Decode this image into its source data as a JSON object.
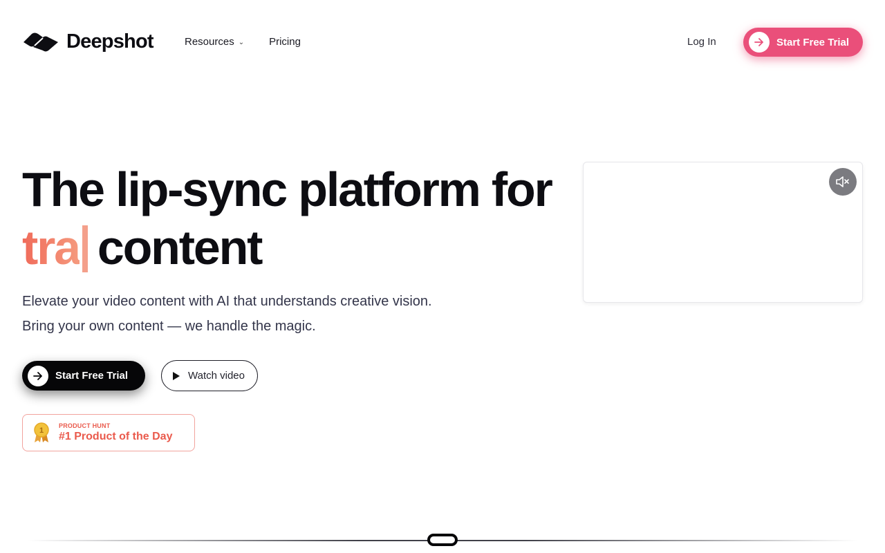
{
  "header": {
    "brand": "Deepshot",
    "nav": [
      {
        "label": "Resources",
        "has_dropdown": true
      },
      {
        "label": "Pricing",
        "has_dropdown": false
      }
    ],
    "login_label": "Log In",
    "cta_label": "Start Free Trial"
  },
  "hero": {
    "title_line1": "The lip-sync platform for",
    "title_typed": "tra",
    "title_line2_rest": "content",
    "subtitle_line1": "Elevate your video content with AI that understands creative vision.",
    "subtitle_line2": "Bring your own content — we handle the magic.",
    "primary_cta": "Start Free Trial",
    "secondary_cta": "Watch video",
    "badge": {
      "kicker": "PRODUCT HUNT",
      "title": "#1 Product of the Day",
      "medal_number": "1"
    }
  },
  "video": {
    "muted": true
  },
  "colors": {
    "accent_pink": "#ea4f7a",
    "typed_gradient_start": "#f06b5a",
    "typed_gradient_end": "#f59a7e",
    "badge_red": "#ea5a4c",
    "text_dark": "#0d0d12"
  },
  "icons": [
    "logo-icon",
    "chevron-down-icon",
    "arrow-right-icon",
    "play-icon",
    "medal-icon",
    "mute-icon"
  ]
}
